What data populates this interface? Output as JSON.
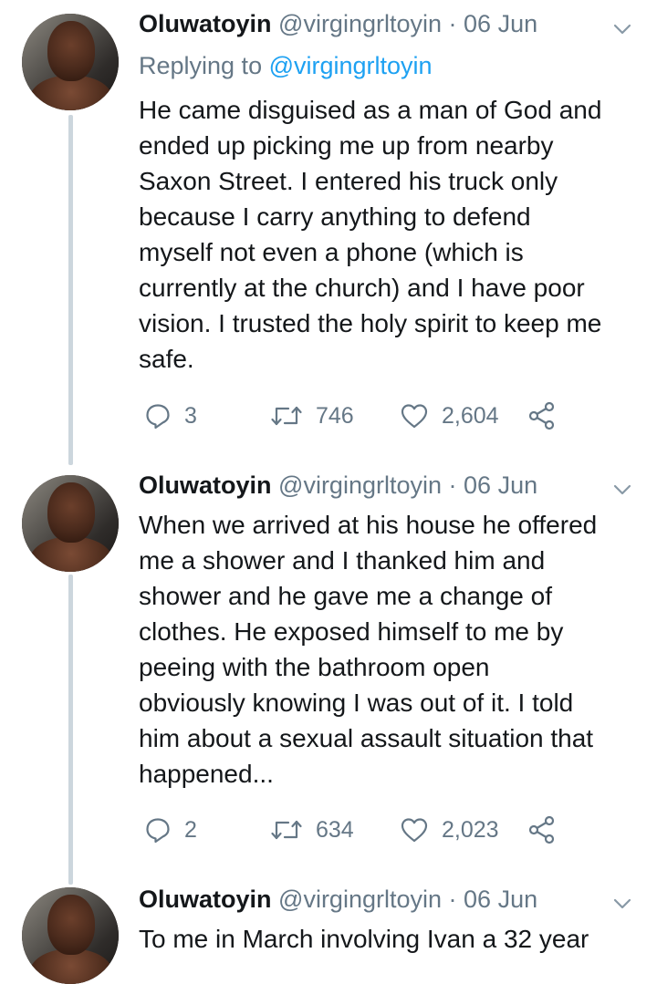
{
  "tweets": [
    {
      "name": "Oluwatoyin",
      "handle": "@virgingrltoyin",
      "separator": "·",
      "date": "06 Jun",
      "reply_prefix": "Replying to",
      "reply_handle": "@virgingrltoyin",
      "lines": [
        "He came disguised as a man of God and",
        "ended up picking me up from nearby",
        "Saxon Street. I entered his truck only",
        "because I carry anything to defend",
        "myself not even a phone (which is",
        "currently at the church) and I have poor",
        "vision. I trusted the holy spirit to keep me",
        "safe."
      ],
      "replies": "3",
      "retweets": "746",
      "likes": "2,604"
    },
    {
      "name": "Oluwatoyin",
      "handle": "@virgingrltoyin",
      "separator": "·",
      "date": "06 Jun",
      "lines": [
        "When we arrived at his house he offered",
        "me a shower and I thanked him and",
        "shower and he gave me a change of",
        "clothes. He exposed himself to me by",
        "peeing with the bathroom open",
        "obviously knowing I was out of it. I told",
        "him about a sexual assault situation that",
        "happened..."
      ],
      "replies": "2",
      "retweets": "634",
      "likes": "2,023"
    },
    {
      "name": "Oluwatoyin",
      "handle": "@virgingrltoyin",
      "separator": "·",
      "date": "06 Jun",
      "lines": [
        "To me in March involving Ivan a 32 year"
      ]
    }
  ],
  "icons": {
    "reply": "reply-icon",
    "retweet": "retweet-icon",
    "like": "heart-icon",
    "share": "share-icon",
    "menu": "chevron-down-icon"
  },
  "colors": {
    "text": "#14171a",
    "muted": "#657786",
    "link": "#1da1f2",
    "thread_line": "#ccd6dd"
  }
}
